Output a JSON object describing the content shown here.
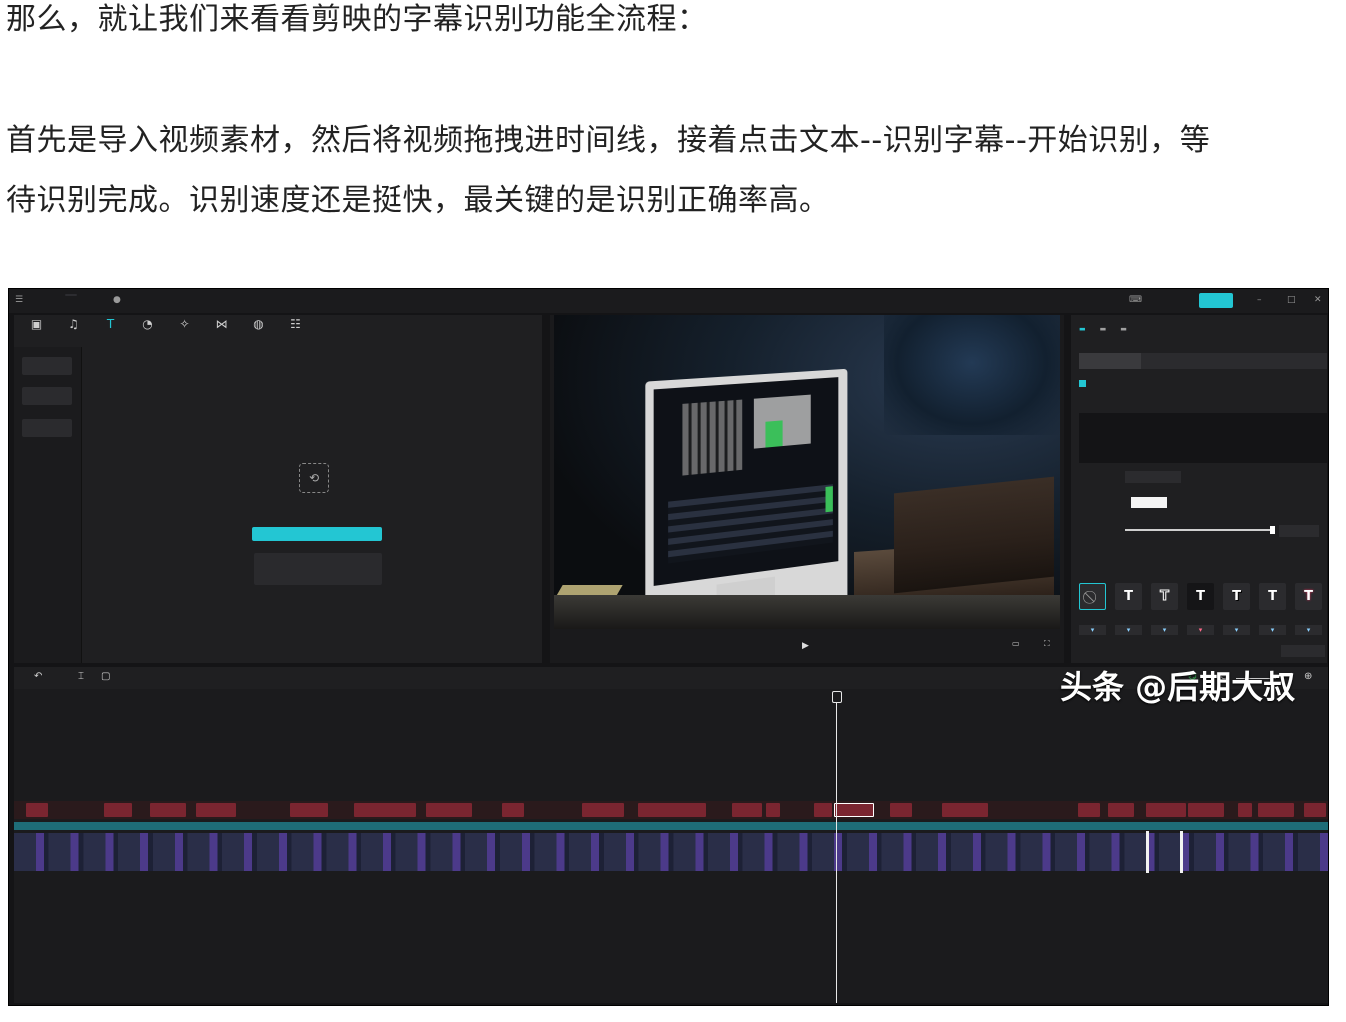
{
  "article": {
    "line1": "那么，就让我们来看看剪映的字幕识别功能全流程：",
    "line2": "首先是导入视频素材，然后将视频拖拽进时间线，接着点击文本--识别字幕--开始识别，等",
    "line3": "待识别完成。识别速度还是挺快，最关键的是识别正确率高。"
  },
  "watermark": "头条 @后期大叔",
  "colors": {
    "accent": "#23c6d3",
    "subtitle_clip": "#7a2530",
    "background": "#141416"
  }
}
